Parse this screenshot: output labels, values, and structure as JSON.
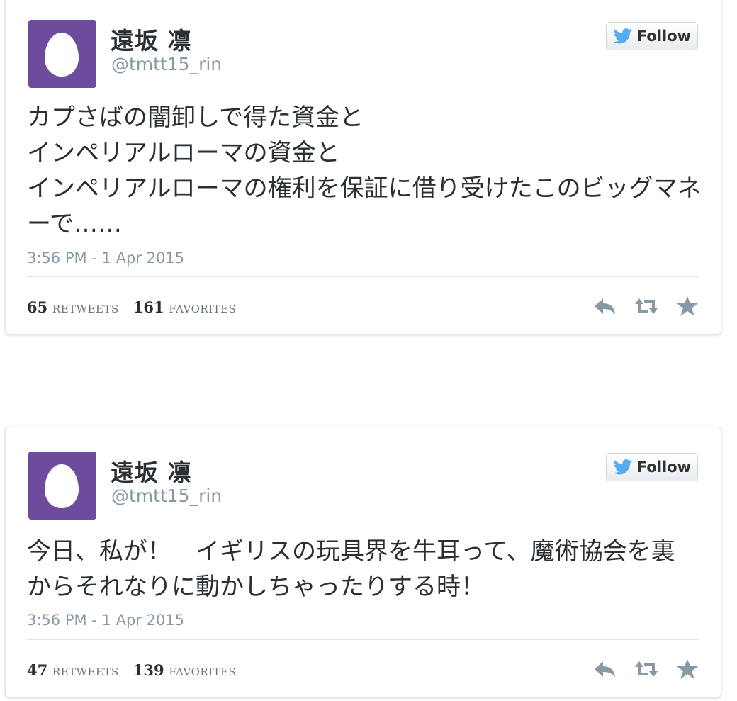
{
  "tweets": [
    {
      "author": {
        "name": "遠坂 凛",
        "handle": "@tmtt15_rin"
      },
      "follow_label": "Follow",
      "text_lines": [
        "カプさばの闇卸しで得た資金と",
        "インペリアルローマの資金と",
        "インペリアルローマの権利を保証に借り受けたこのビッグマネ",
        "ーで……"
      ],
      "timestamp": "3:56 PM - 1 Apr 2015",
      "retweets": "65",
      "retweets_label": "RETWEETS",
      "favorites": "161",
      "favorites_label": "FAVORITES",
      "icons": [
        "twitter-bird-icon",
        "reply-icon",
        "retweet-icon",
        "favorite-star-icon"
      ]
    },
    {
      "author": {
        "name": "遠坂 凛",
        "handle": "@tmtt15_rin"
      },
      "follow_label": "Follow",
      "text_lines": [
        "今日、私が！　イギリスの玩具界を牛耳って、魔術協会を裏",
        "からそれなりに動かしちゃったりする時！"
      ],
      "timestamp": "3:56 PM - 1 Apr 2015",
      "retweets": "47",
      "retweets_label": "RETWEETS",
      "favorites": "139",
      "favorites_label": "FAVORITES",
      "icons": [
        "twitter-bird-icon",
        "reply-icon",
        "retweet-icon",
        "favorite-star-icon"
      ]
    }
  ],
  "colors": {
    "avatar_bg": "#6f4b9e",
    "twitter_blue": "#55acee",
    "action_gray": "#8899a6",
    "text": "#292f33"
  }
}
